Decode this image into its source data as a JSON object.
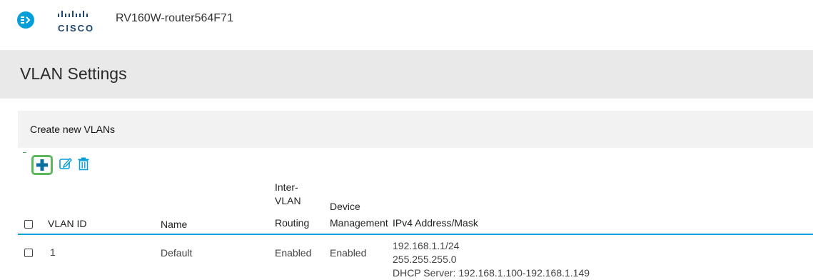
{
  "app": {
    "device_name": "RV160W-router564F71",
    "logo_word": "CISCO"
  },
  "page": {
    "title": "VLAN Settings"
  },
  "panel": {
    "title": "Create new VLANs",
    "toolbar": {
      "add_icon": "plus-icon",
      "edit_icon": "edit-icon",
      "delete_icon": "trash-icon"
    }
  },
  "table": {
    "headers": {
      "vlan_id": "VLAN ID",
      "name": "Name",
      "inter_vlan_line1": "Inter-",
      "inter_vlan_line2": "VLAN",
      "inter_vlan_line3": "Routing",
      "device_mgmt_line1": "Device",
      "device_mgmt_line2": "Management",
      "ipv4": "IPv4 Address/Mask"
    },
    "rows": [
      {
        "vlan_id": "1",
        "name": "Default",
        "inter_vlan_routing": "Enabled",
        "device_management": "Enabled",
        "ipv4_address": "192.168.1.1/24",
        "ipv4_mask": "255.255.255.0",
        "dhcp": "DHCP Server: 192.168.1.100-192.168.1.149"
      }
    ]
  },
  "colors": {
    "accent_blue": "#049fd9",
    "highlight_green": "#5cb85c",
    "cisco_navy": "#1e4471"
  }
}
